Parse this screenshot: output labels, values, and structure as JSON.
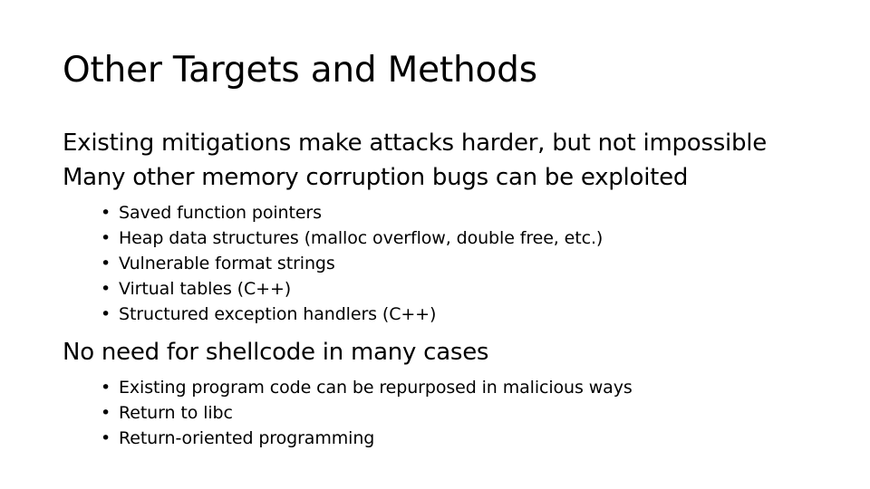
{
  "slide": {
    "title": "Other Targets and Methods",
    "background_color": "#ffffff",
    "text_color": "#000000",
    "bullet_glyph": "•",
    "intro_lines": [
      "Existing mitigations make attacks harder, but not impossible",
      "Many other memory corruption bugs can be exploited"
    ],
    "targets_bullets": [
      "Saved function pointers",
      "Heap data structures (malloc overflow, double free, etc.)",
      "Vulnerable format strings",
      "Virtual tables (C++)",
      "Structured exception handlers (C++)"
    ],
    "section_heading": "No need for shellcode in many cases",
    "section_bullets": [
      "Existing program code can be repurposed in malicious ways",
      "Return to libc",
      "Return-oriented programming"
    ]
  }
}
